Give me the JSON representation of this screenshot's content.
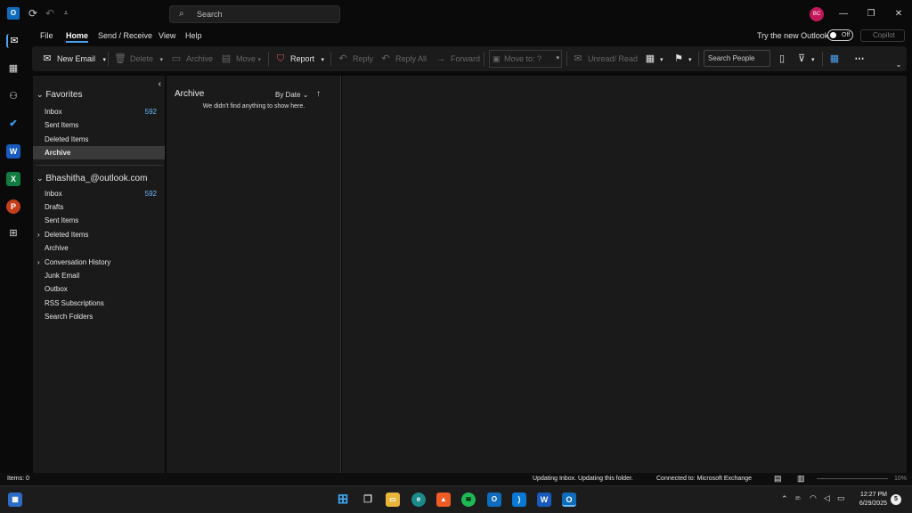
{
  "titlebar": {
    "search_placeholder": "Search",
    "avatar_initials": "BC",
    "minimize": "—",
    "restore": "❐",
    "close": "✕"
  },
  "menu": {
    "tabs": [
      "File",
      "Home",
      "Send / Receive",
      "View",
      "Help"
    ],
    "active_tab": "Home",
    "try_new_outlook": "Try the new Outlook",
    "toggle_state": "Off",
    "copilot": "Copilot"
  },
  "ribbon": {
    "new_email": "New Email",
    "delete": "Delete",
    "archive": "Archive",
    "move": "Move",
    "report": "Report",
    "reply": "Reply",
    "reply_all": "Reply All",
    "forward": "Forward",
    "move_to": "Move to: ?",
    "unread_read": "Unread/ Read",
    "search_people": "Search People"
  },
  "folders": {
    "favorites_label": "Favorites",
    "favorites": [
      {
        "label": "Inbox",
        "count": "592"
      },
      {
        "label": "Sent Items",
        "count": ""
      },
      {
        "label": "Deleted Items",
        "count": ""
      },
      {
        "label": "Archive",
        "count": ""
      }
    ],
    "account_label": "Bhashitha_@outlook.com",
    "account": [
      {
        "label": "Inbox",
        "count": "592"
      },
      {
        "label": "Drafts",
        "count": ""
      },
      {
        "label": "Sent Items",
        "count": ""
      },
      {
        "label": "Deleted Items",
        "count": ""
      },
      {
        "label": "Archive",
        "count": ""
      },
      {
        "label": "Conversation History",
        "count": ""
      },
      {
        "label": "Junk Email",
        "count": ""
      },
      {
        "label": "Outbox",
        "count": ""
      },
      {
        "label": "RSS Subscriptions",
        "count": ""
      },
      {
        "label": "Search Folders",
        "count": ""
      }
    ]
  },
  "message_list": {
    "title": "Archive",
    "sort": "By Date",
    "empty_text": "We didn't find anything to show here."
  },
  "status": {
    "items": "Items: 0",
    "updating": "Updating Inbox.  Updating this folder.",
    "connected": "Connected to: Microsoft Exchange",
    "zoom": "10%"
  },
  "taskbar": {
    "time": "12:27 PM",
    "date": "6/29/2025",
    "notif_count": "5"
  },
  "colors": {
    "accent": "#4aa3f0",
    "count_blue": "#6cb8f6",
    "avatar_bg": "#c2185b"
  }
}
